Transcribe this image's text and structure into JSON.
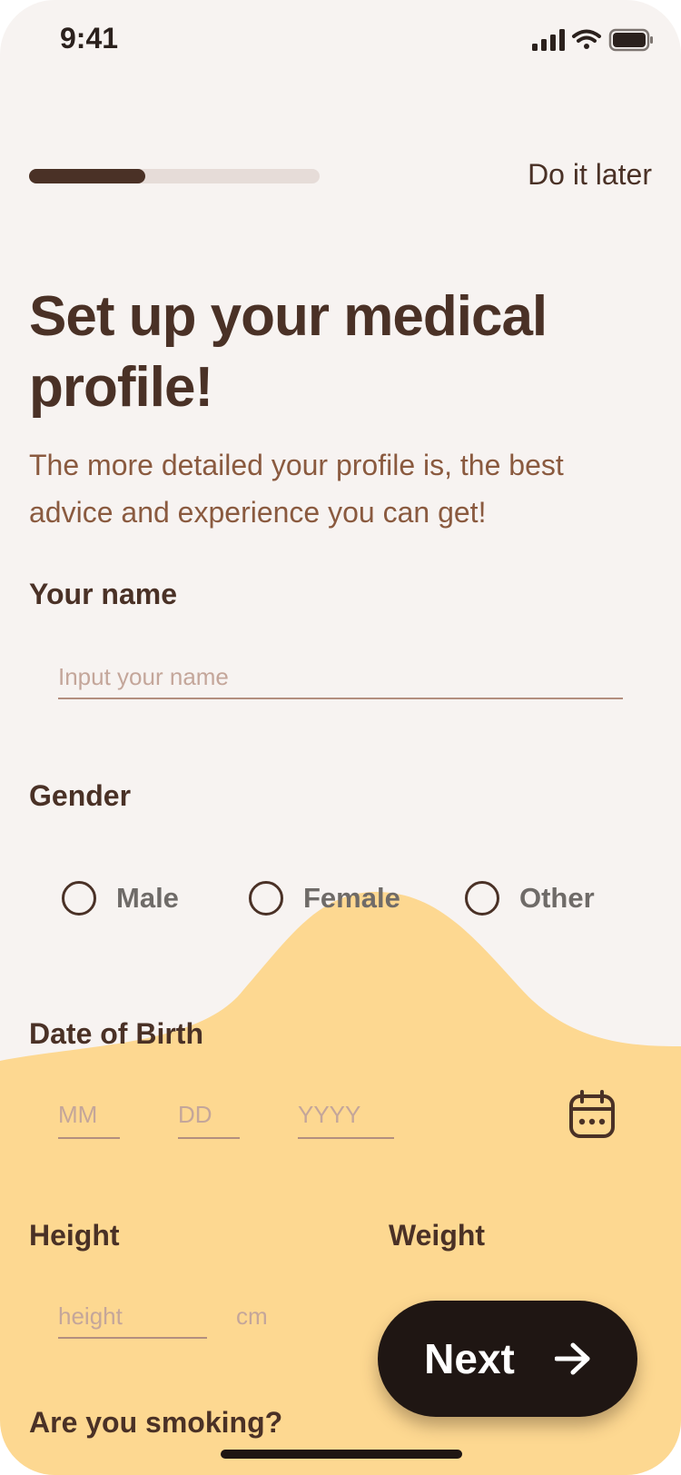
{
  "status_bar": {
    "time": "9:41"
  },
  "header": {
    "progress": 0.4,
    "skip_label": "Do it later"
  },
  "page": {
    "title": "Set up your medical profile!",
    "subtitle": "The more detailed your profile is, the best advice and experience you can get!"
  },
  "name": {
    "label": "Your name",
    "placeholder": "Input your name"
  },
  "gender": {
    "label": "Gender",
    "options": [
      "Male",
      "Female",
      "Other"
    ]
  },
  "dob": {
    "label": "Date of Birth",
    "month_placeholder": "MM",
    "day_placeholder": "DD",
    "year_placeholder": "YYYY"
  },
  "height": {
    "label": "Height",
    "placeholder": "height",
    "unit": "cm"
  },
  "weight": {
    "label": "Weight"
  },
  "smoking": {
    "label": "Are you smoking?"
  },
  "next_button": {
    "label": "Next"
  },
  "colors": {
    "background": "#f7f3f1",
    "accent_yellow": "#fdd891",
    "brown": "#4a3126",
    "dark": "#1f1613"
  }
}
